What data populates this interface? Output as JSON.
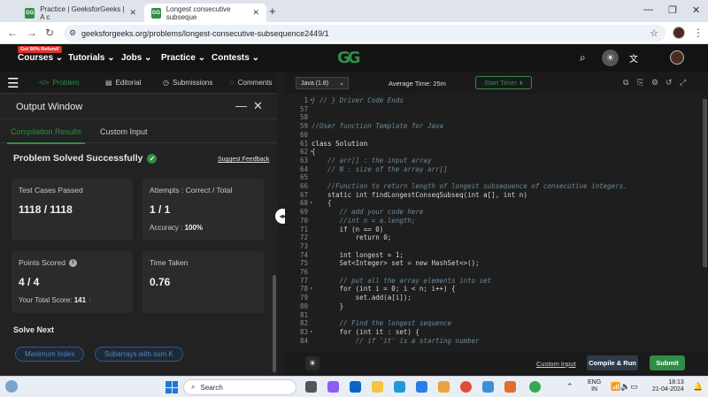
{
  "browser": {
    "tabs": [
      {
        "title": "Practice | GeeksforGeeks | A c"
      },
      {
        "title": "Longest consecutive subseque"
      }
    ],
    "url": "geeksforgeeks.org/problems/longest-consecutive-subsequence2449/1"
  },
  "site": {
    "refund_badge": "Get 90% Refund!",
    "nav": [
      "Courses",
      "Tutorials",
      "Jobs",
      "Practice",
      "Contests"
    ],
    "logo": "GG"
  },
  "problem_tabs": [
    "Problem",
    "Editorial",
    "Submissions",
    "Comments"
  ],
  "output_window": {
    "title": "Output Window",
    "tabs": [
      "Compilation Results",
      "Custom Input"
    ],
    "status": "Problem Solved Successfully",
    "feedback": "Suggest Feedback",
    "cards": {
      "test_cases": {
        "label": "Test Cases Passed",
        "value": "1118 / 1118"
      },
      "attempts": {
        "label": "Attempts : Correct / Total",
        "value": "1 / 1",
        "sub_label": "Accuracy :",
        "sub_value": "100%"
      },
      "points": {
        "label": "Points Scored",
        "value": "4 / 4",
        "sub_label": "Your Total Score:",
        "sub_value": "141"
      },
      "time": {
        "label": "Time Taken",
        "value": "0.76"
      }
    },
    "solve_next": "Solve Next",
    "chips": [
      "Maximum Index",
      "Subarrays with sum K"
    ]
  },
  "editor": {
    "language": "Java (1.8)",
    "avg_time": "Average Time: 25m",
    "timer": "Start Timer",
    "lines": [
      {
        "n": "1",
        "t": "} // } Driver Code Ends",
        "cls": "cm",
        "fold": true
      },
      {
        "n": "57",
        "t": ""
      },
      {
        "n": "58",
        "t": ""
      },
      {
        "n": "59",
        "t": "//User function Template for Java",
        "cls": "cm"
      },
      {
        "n": "60",
        "t": ""
      },
      {
        "n": "61",
        "t": "class Solution",
        "cls": "nm"
      },
      {
        "n": "62",
        "t": "{",
        "fold": true
      },
      {
        "n": "63",
        "t": "    // arr[] : the input array",
        "cls": "cm"
      },
      {
        "n": "64",
        "t": "    // N : size of the array arr[]",
        "cls": "cm"
      },
      {
        "n": "65",
        "t": ""
      },
      {
        "n": "66",
        "t": "    //Function to return length of longest subsequence of consecutive integers.",
        "cls": "cm"
      },
      {
        "n": "67",
        "t": "    static int findLongestConseqSubseq(int a[], int n)"
      },
      {
        "n": "68",
        "t": "    {",
        "fold": true
      },
      {
        "n": "69",
        "t": "       // add your code here",
        "cls": "cm"
      },
      {
        "n": "70",
        "t": "       //int n = a.length;",
        "cls": "cm"
      },
      {
        "n": "71",
        "t": "       if (n == 0)"
      },
      {
        "n": "72",
        "t": "           return 0;"
      },
      {
        "n": "73",
        "t": ""
      },
      {
        "n": "74",
        "t": "       int longest = 1;"
      },
      {
        "n": "75",
        "t": "       Set<Integer> set = new HashSet<>();"
      },
      {
        "n": "76",
        "t": ""
      },
      {
        "n": "77",
        "t": "       // put all the array elements into set",
        "cls": "cm"
      },
      {
        "n": "78",
        "t": "       for (int i = 0; i < n; i++) {",
        "fold": true
      },
      {
        "n": "79",
        "t": "           set.add(a[i]);"
      },
      {
        "n": "80",
        "t": "       }"
      },
      {
        "n": "81",
        "t": ""
      },
      {
        "n": "82",
        "t": "       // Find the longest sequence",
        "cls": "cm"
      },
      {
        "n": "83",
        "t": "       for (int it : set) {",
        "fold": true
      },
      {
        "n": "84",
        "t": "           // if 'it' is a starting number",
        "cls": "cm"
      }
    ],
    "custom_input": "Custom Input",
    "compile_btn": "Compile & Run",
    "submit_btn": "Submit"
  },
  "taskbar": {
    "search": "Search",
    "lang": "ENG",
    "region": "IN",
    "time": "18:13",
    "date": "21-04-2024"
  },
  "colors": {
    "brand_green": "#2f8d46",
    "dark_bg": "#1e1e1e"
  }
}
